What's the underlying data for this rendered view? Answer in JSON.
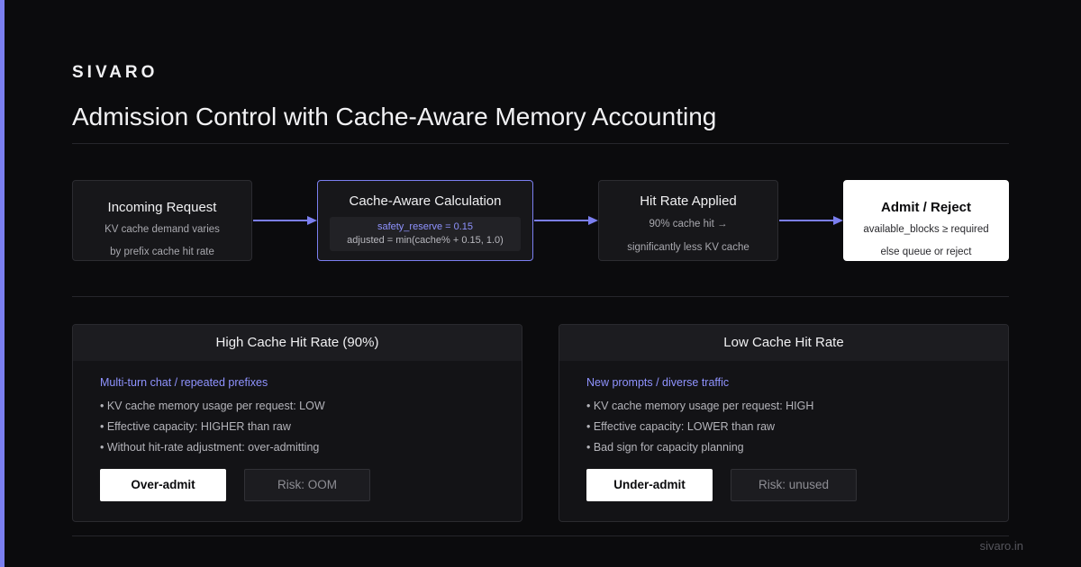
{
  "brand": "SIVARO",
  "title": "Admission Control with Cache-Aware Memory Accounting",
  "flow": {
    "incoming": {
      "title": "Incoming Request",
      "line1": "KV cache demand varies",
      "line2": "by prefix cache hit rate"
    },
    "calc": {
      "title": "Cache-Aware Calculation",
      "code1": "safety_reserve = 0.15",
      "code2": "adjusted = min(cache% + 0.15, 1.0)"
    },
    "hitrate": {
      "title": "Hit Rate Applied",
      "line1": "90% cache hit →",
      "line2": "significantly less KV cache"
    },
    "admit": {
      "title": "Admit / Reject",
      "line1": "available_blocks ≥ required",
      "line2": "else queue or reject"
    }
  },
  "panels": {
    "high": {
      "title": "High Cache Hit Rate (90%)",
      "subtitle": "Multi-turn chat / repeated prefixes",
      "bullets": [
        "• KV cache memory usage per request: LOW",
        "• Effective capacity: HIGHER than raw",
        "• Without hit-rate adjustment: over-admitting"
      ],
      "primary_label": "Over-admit",
      "secondary_label": "Risk: OOM"
    },
    "low": {
      "title": "Low Cache Hit Rate",
      "subtitle": "New prompts / diverse traffic",
      "bullets": [
        "• KV cache memory usage per request: HIGH",
        "• Effective capacity: LOWER than raw",
        "• Bad sign for capacity planning"
      ],
      "primary_label": "Under-admit",
      "secondary_label": "Risk: unused"
    }
  },
  "footer": "sivaro.in",
  "colors": {
    "accent": "#7b7ff0",
    "background": "#0b0b0d",
    "box": "#17171a"
  }
}
